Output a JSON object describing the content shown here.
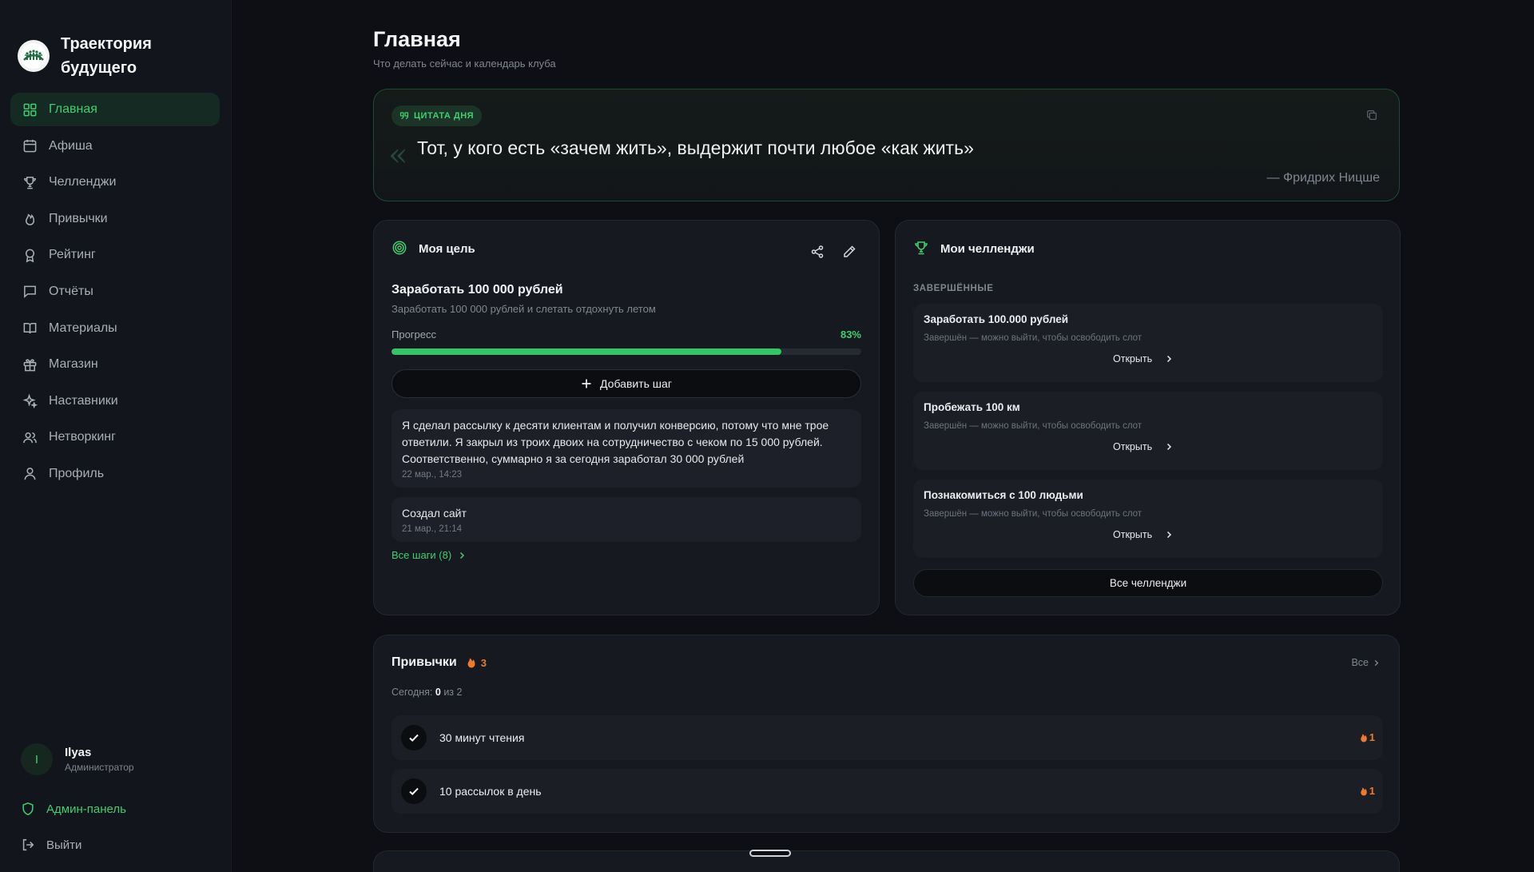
{
  "brand": {
    "name": "Траектория будущего"
  },
  "nav": [
    {
      "label": "Главная",
      "icon": "grid-icon",
      "active": true
    },
    {
      "label": "Афиша",
      "icon": "calendar-icon"
    },
    {
      "label": "Челленджи",
      "icon": "trophy-icon"
    },
    {
      "label": "Привычки",
      "icon": "flame-icon"
    },
    {
      "label": "Рейтинг",
      "icon": "award-icon"
    },
    {
      "label": "Отчёты",
      "icon": "message-icon"
    },
    {
      "label": "Материалы",
      "icon": "book-icon"
    },
    {
      "label": "Магазин",
      "icon": "gift-icon"
    },
    {
      "label": "Наставники",
      "icon": "sparkles-icon"
    },
    {
      "label": "Нетворкинг",
      "icon": "users-icon"
    },
    {
      "label": "Профиль",
      "icon": "user-icon"
    }
  ],
  "user": {
    "initial": "I",
    "name": "Ilyas",
    "role": "Администратор"
  },
  "admin_label": "Админ-панель",
  "logout_label": "Выйти",
  "page": {
    "title": "Главная",
    "subtitle": "Что делать сейчас и календарь клуба"
  },
  "quote": {
    "badge": "ЦИТАТА ДНЯ",
    "text": "Тот, у кого есть «зачем жить», выдержит почти любое «как жить»",
    "author": "— Фридрих Ницше"
  },
  "goal": {
    "header": "Моя цель",
    "title": "Заработать 100 000 рублей",
    "description": "Заработать 100 000 рублей и слетать отдохнуть летом",
    "progress_label": "Прогресс",
    "progress_text": "83%",
    "progress_value": 0.83,
    "add_step_label": "Добавить шаг",
    "steps": [
      {
        "text": "Я сделал рассылку к десяти клиентам и получил конверсию, потому что мне трое ответили. Я закрыл из троих двоих на сотрудничество с чеком по 15 000 рублей. Соответственно, суммарно я за сегодня заработал 30 000 рублей",
        "time": "22 мар., 14:23"
      },
      {
        "text": "Создал сайт",
        "time": "21 мар., 21:14"
      }
    ],
    "all_steps_label": "Все шаги (8)"
  },
  "challenges": {
    "header": "Мои челленджи",
    "section": "ЗАВЕРШЁННЫЕ",
    "items": [
      {
        "title": "Заработать 100.000 рублей",
        "subtitle": "Завершён — можно выйти, чтобы освободить слот",
        "open_label": "Открыть"
      },
      {
        "title": "Пробежать 100 км",
        "subtitle": "Завершён — можно выйти, чтобы освободить слот",
        "open_label": "Открыть"
      },
      {
        "title": "Познакомиться с 100 людьми",
        "subtitle": "Завершён — можно выйти, чтобы освободить слот",
        "open_label": "Открыть"
      }
    ],
    "all_label": "Все челленджи"
  },
  "habits": {
    "title": "Привычки",
    "streak": "3",
    "all_label": "Все",
    "today_prefix": "Сегодня:",
    "today_done": "0",
    "today_suffix": "из 2",
    "items": [
      {
        "name": "30 минут чтения",
        "streak": "1"
      },
      {
        "name": "10 рассылок в день",
        "streak": "1"
      }
    ]
  },
  "colors": {
    "accent": "#3ecf6e",
    "streak": "#f07a2c",
    "background": "#0d0f14",
    "card": "#161920"
  }
}
